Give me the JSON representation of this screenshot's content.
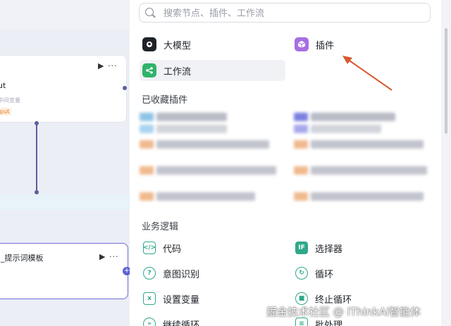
{
  "canvas": {
    "node1": {
      "title": "ut",
      "subtitle": "中间变量",
      "tag": "put",
      "icons": "▶ ···"
    },
    "node2": {
      "title": "_提示词模板",
      "icons": "▶ ···"
    },
    "plus": "+"
  },
  "panel": {
    "search": {
      "placeholder": "搜索节点、插件、工作流"
    },
    "top_items": [
      {
        "label": "大模型",
        "icon": "llm-icon",
        "color": "#1f2329"
      },
      {
        "label": "插件",
        "icon": "plugin-icon",
        "color": "#a86ee0"
      },
      {
        "label": "工作流",
        "icon": "workflow-icon",
        "color": "#2fb36b"
      }
    ],
    "favorites_heading": "已收藏插件",
    "business_heading": "业务逻辑",
    "logic_items": [
      {
        "label": "代码",
        "icon": "code-icon"
      },
      {
        "label": "选择器",
        "icon": "selector-icon"
      },
      {
        "label": "意图识别",
        "icon": "intent-icon"
      },
      {
        "label": "循环",
        "icon": "loop-icon"
      },
      {
        "label": "设置变量",
        "icon": "set-variable-icon"
      },
      {
        "label": "终止循环",
        "icon": "stop-loop-icon"
      },
      {
        "label": "继续循环",
        "icon": "continue-loop-icon"
      },
      {
        "label": "批处理",
        "icon": "batch-icon"
      }
    ],
    "accent_color": "#2fa88a",
    "arrow_color": "#d9572f"
  },
  "watermark": "掘金技术社区 @ iThinkAi智能体"
}
